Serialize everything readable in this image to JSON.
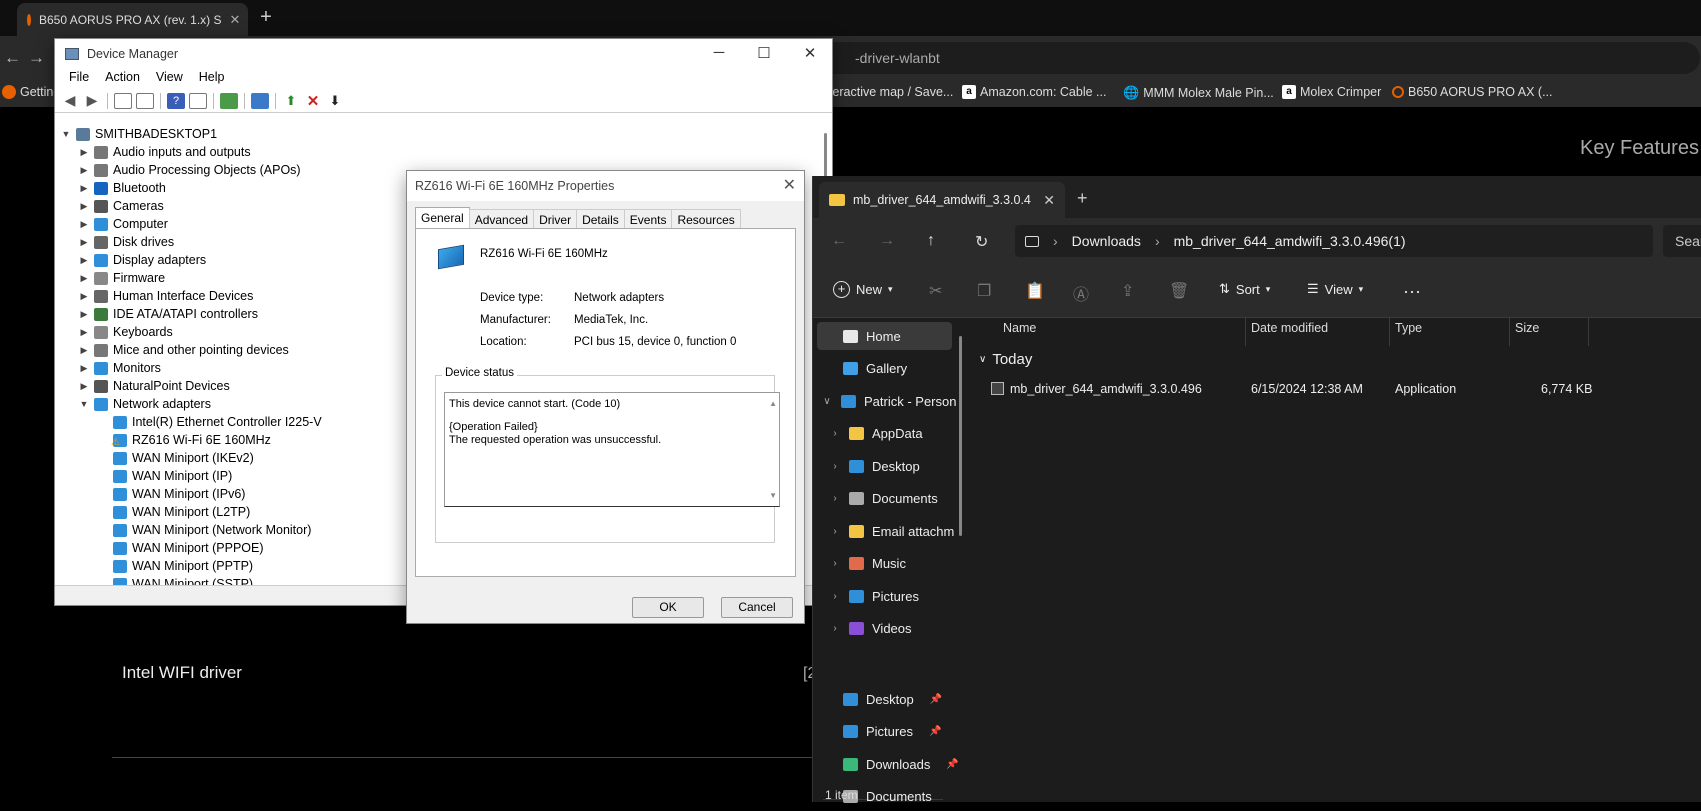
{
  "browser": {
    "tab_title": "B650 AORUS PRO AX (rev. 1.x) S",
    "url_text": "-driver-wlanbt",
    "bookmarks": [
      {
        "label": "Getting S",
        "color": "#e66000"
      },
      {
        "label": "nteractive map / Save...",
        "color": "#2a2a2a"
      },
      {
        "label": "Amazon.com: Cable ...",
        "color": "#ffffff"
      },
      {
        "label": "MMM Molex Male Pin...",
        "color": "#999999"
      },
      {
        "label": "Molex Crimper",
        "color": "#ffffff"
      },
      {
        "label": "B650 AORUS PRO AX (...",
        "color": "#e66000"
      }
    ],
    "page_heading": "Key Features",
    "page_link": "Intel WIFI driver",
    "page_fragment": "[2"
  },
  "device_manager": {
    "title": "Device Manager",
    "menu": [
      "File",
      "Action",
      "View",
      "Help"
    ],
    "computer": "SMITHBADESKTOP1",
    "categories": [
      {
        "label": "Audio inputs and outputs",
        "icon": "speaker-icon",
        "color": "#777"
      },
      {
        "label": "Audio Processing Objects (APOs)",
        "icon": "speaker-icon",
        "color": "#777"
      },
      {
        "label": "Bluetooth",
        "icon": "bluetooth-icon",
        "color": "#1565c0"
      },
      {
        "label": "Cameras",
        "icon": "camera-icon",
        "color": "#555"
      },
      {
        "label": "Computer",
        "icon": "computer-icon",
        "color": "#2f8fd8"
      },
      {
        "label": "Disk drives",
        "icon": "disk-icon",
        "color": "#666"
      },
      {
        "label": "Display adapters",
        "icon": "display-icon",
        "color": "#2f8fd8"
      },
      {
        "label": "Firmware",
        "icon": "chip-icon",
        "color": "#888"
      },
      {
        "label": "Human Interface Devices",
        "icon": "hid-icon",
        "color": "#666"
      },
      {
        "label": "IDE ATA/ATAPI controllers",
        "icon": "controller-icon",
        "color": "#3a7a3a"
      },
      {
        "label": "Keyboards",
        "icon": "keyboard-icon",
        "color": "#888"
      },
      {
        "label": "Mice and other pointing devices",
        "icon": "mouse-icon",
        "color": "#777"
      },
      {
        "label": "Monitors",
        "icon": "monitor-icon",
        "color": "#2f8fd8"
      },
      {
        "label": "NaturalPoint Devices",
        "icon": "usb-icon",
        "color": "#555"
      },
      {
        "label": "Network adapters",
        "icon": "network-icon",
        "color": "#2f8fd8"
      }
    ],
    "network_children": [
      {
        "label": "Intel(R) Ethernet Controller I225-V",
        "warn": false
      },
      {
        "label": "RZ616 Wi-Fi 6E 160MHz",
        "warn": true
      },
      {
        "label": "WAN Miniport (IKEv2)",
        "warn": false
      },
      {
        "label": "WAN Miniport (IP)",
        "warn": false
      },
      {
        "label": "WAN Miniport (IPv6)",
        "warn": false
      },
      {
        "label": "WAN Miniport (L2TP)",
        "warn": false
      },
      {
        "label": "WAN Miniport (Network Monitor)",
        "warn": false
      },
      {
        "label": "WAN Miniport (PPPOE)",
        "warn": false
      },
      {
        "label": "WAN Miniport (PPTP)",
        "warn": false
      },
      {
        "label": "WAN Miniport (SSTP)",
        "warn": false
      }
    ]
  },
  "properties": {
    "title": "RZ616 Wi-Fi 6E 160MHz Properties",
    "tabs": [
      "General",
      "Advanced",
      "Driver",
      "Details",
      "Events",
      "Resources"
    ],
    "device_name": "RZ616 Wi-Fi 6E 160MHz",
    "fields": [
      {
        "label": "Device type:",
        "value": "Network adapters"
      },
      {
        "label": "Manufacturer:",
        "value": "MediaTek, Inc."
      },
      {
        "label": "Location:",
        "value": "PCI bus 15, device 0, function 0"
      }
    ],
    "status_title": "Device status",
    "status_line1": "This device cannot start. (Code 10)",
    "status_line2": "{Operation Failed}",
    "status_line3": "The requested operation was unsuccessful.",
    "ok": "OK",
    "cancel": "Cancel"
  },
  "explorer": {
    "tab_title": "mb_driver_644_amdwifi_3.3.0.4",
    "crumbs": [
      "Downloads",
      "mb_driver_644_amdwifi_3.3.0.496(1)"
    ],
    "search": "Sear",
    "new_label": "New",
    "sort_label": "Sort",
    "view_label": "View",
    "nav": [
      {
        "label": "Home",
        "color": "#e8e8e8"
      },
      {
        "label": "Gallery",
        "color": "#3fa0e8"
      },
      {
        "label": "Patrick - Person",
        "color": "#2f8fd8"
      },
      {
        "label": "AppData",
        "color": "#f4c542"
      },
      {
        "label": "Desktop",
        "color": "#2f8fd8"
      },
      {
        "label": "Documents",
        "color": "#aaaaaa"
      },
      {
        "label": "Email attachm",
        "color": "#f4c542"
      },
      {
        "label": "Music",
        "color": "#e06a4a"
      },
      {
        "label": "Pictures",
        "color": "#2f8fd8"
      },
      {
        "label": "Videos",
        "color": "#8a4fd8"
      }
    ],
    "quick": [
      {
        "label": "Desktop",
        "color": "#2f8fd8"
      },
      {
        "label": "Pictures",
        "color": "#2f8fd8"
      },
      {
        "label": "Downloads",
        "color": "#3ab87a"
      },
      {
        "label": "Documents",
        "color": "#aaaaaa"
      }
    ],
    "columns": [
      "Name",
      "Date modified",
      "Type",
      "Size"
    ],
    "group": "Today",
    "file": {
      "name": "mb_driver_644_amdwifi_3.3.0.496",
      "date": "6/15/2024 12:38 AM",
      "type": "Application",
      "size": "6,774 KB"
    },
    "status": "1 item"
  }
}
